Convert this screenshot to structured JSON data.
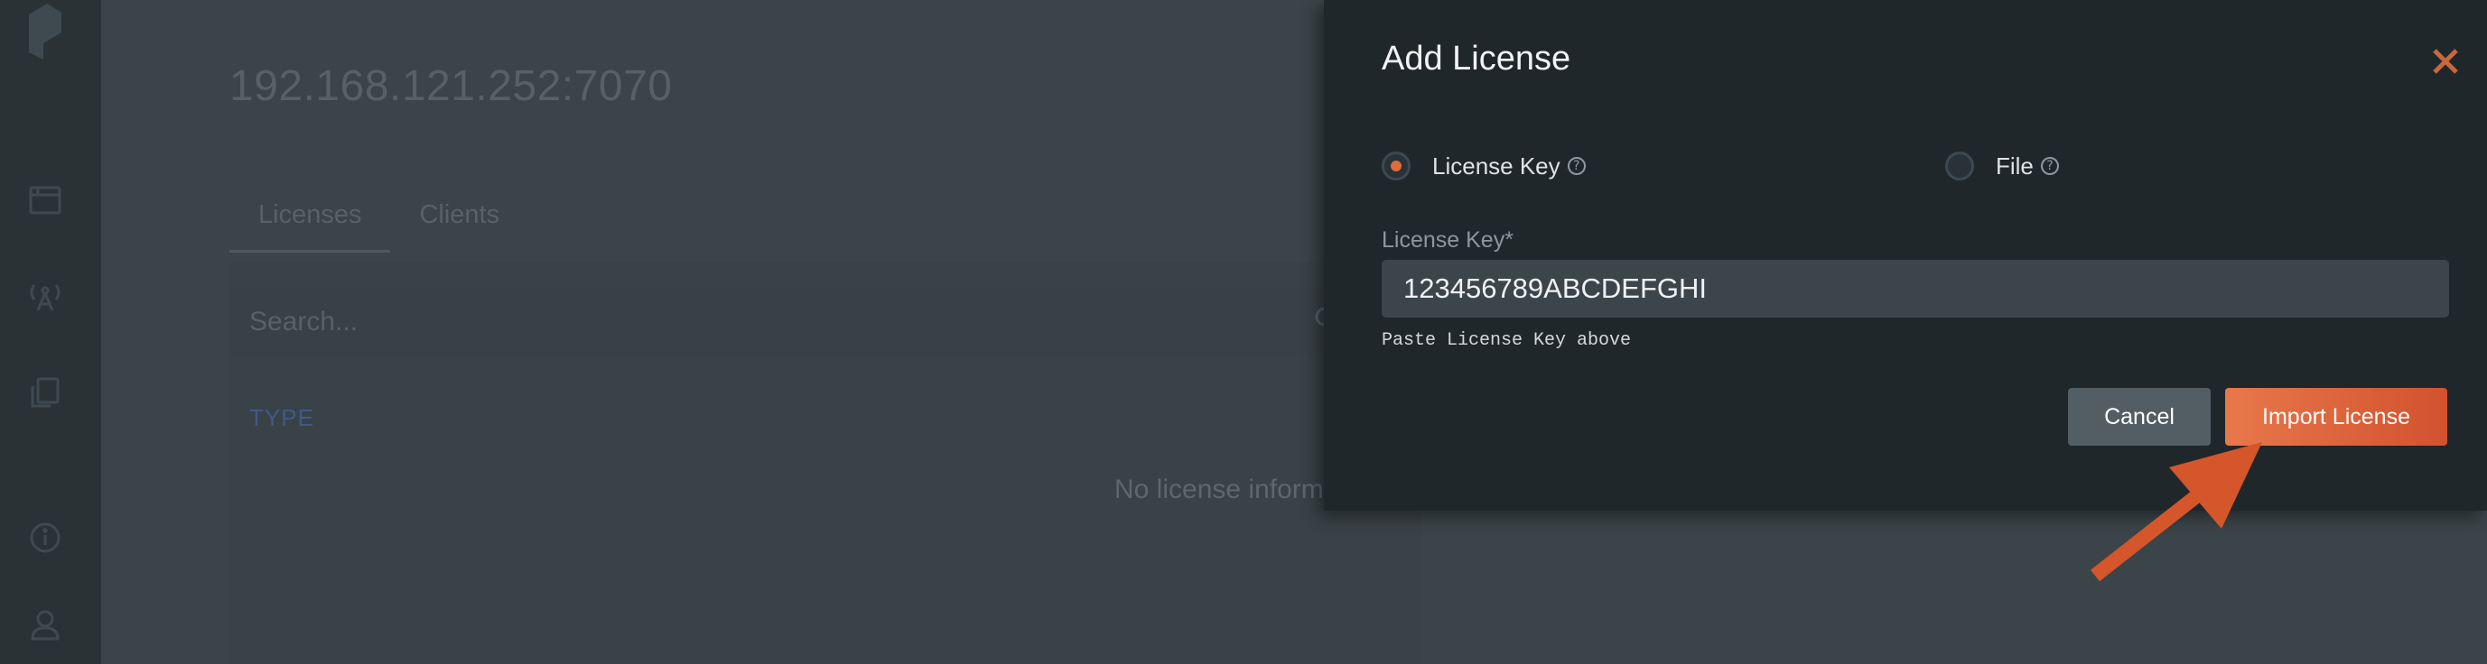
{
  "background": {
    "host_title": "192.168.121.252:7070",
    "tabs": [
      {
        "label": "Licenses",
        "active": true
      },
      {
        "label": "Clients",
        "active": false
      }
    ],
    "search_placeholder": "Search...",
    "column_header": "TYPE",
    "empty_message": "No license information"
  },
  "nav": {
    "icons": [
      "logo-icon",
      "dashboard-icon",
      "broadcast-icon",
      "licenses-icon",
      "info-icon",
      "user-icon"
    ]
  },
  "modal": {
    "title": "Add License",
    "close_icon": "close-icon",
    "options": [
      {
        "label": "License Key",
        "selected": true
      },
      {
        "label": "File",
        "selected": false
      }
    ],
    "field_label": "License Key*",
    "field_value": "123456789ABCDEFGHI",
    "hint": "Paste License Key above",
    "cancel_label": "Cancel",
    "import_label": "Import License"
  },
  "colors": {
    "accent": "#e06a3e",
    "modal_bg": "#1f272b",
    "page_bg": "#3b4448"
  }
}
